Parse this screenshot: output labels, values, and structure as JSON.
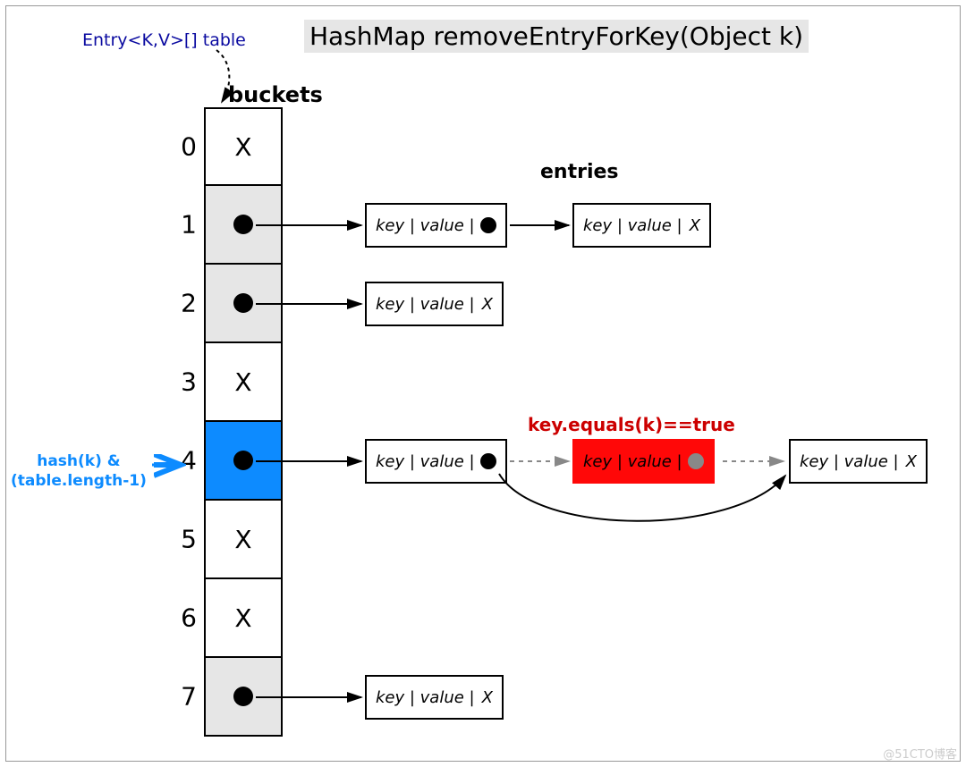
{
  "title": "HashMap removeEntryForKey(Object k)",
  "topLabel": "Entry<K,V>[] table",
  "bucketsLabel": "buckets",
  "entriesLabel": "entries",
  "hashLabel": "hash(k) &\n(table.length-1)",
  "redLabel": "key.equals(k)==true",
  "watermark": "@51CTO博客",
  "buckets": [
    {
      "idx": "0",
      "state": "empty"
    },
    {
      "idx": "1",
      "state": "ptr"
    },
    {
      "idx": "2",
      "state": "ptr"
    },
    {
      "idx": "3",
      "state": "empty"
    },
    {
      "idx": "4",
      "state": "hit"
    },
    {
      "idx": "5",
      "state": "empty"
    },
    {
      "idx": "6",
      "state": "empty"
    },
    {
      "idx": "7",
      "state": "ptr"
    }
  ],
  "nodeText": {
    "kv": "key | value |",
    "end": "X"
  }
}
